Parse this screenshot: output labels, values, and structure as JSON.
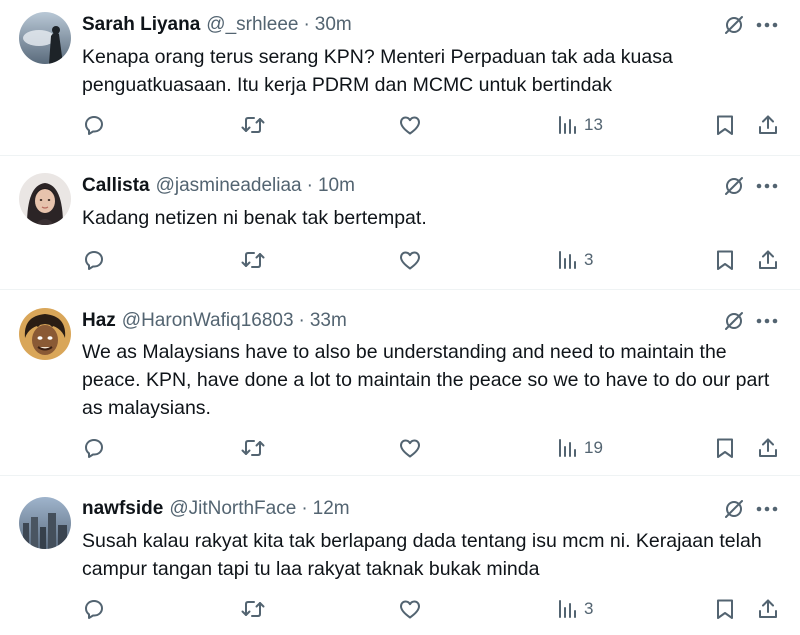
{
  "tweets": [
    {
      "name": "Sarah Liyana",
      "handle": "@_srhleee",
      "sep": "·",
      "time": "30m",
      "text": "Kenapa orang terus serang KPN? Menteri Perpaduan tak ada kuasa penguatkuasaan. Itu kerja PDRM dan MCMC untuk bertindak",
      "views": "13"
    },
    {
      "name": "Callista",
      "handle": "@jasmineadeliaa",
      "sep": "·",
      "time": "10m",
      "text": "Kadang netizen ni benak tak bertempat.",
      "views": "3"
    },
    {
      "name": "Haz",
      "handle": "@HaronWafiq16803",
      "sep": "·",
      "time": "33m",
      "text": "We as Malaysians have to also be understanding and need to maintain the peace. KPN, have done a lot to maintain the peace so we to have to do our part as malaysians.",
      "views": "19"
    },
    {
      "name": "nawfside",
      "handle": "@JitNorthFace",
      "sep": "·",
      "time": "12m",
      "text": "Susah kalau rakyat kita tak berlapang dada tentang isu mcm ni. Kerajaan telah campur tangan tapi tu laa rakyat taknak bukak minda",
      "views": "3"
    }
  ],
  "icons": {
    "reply": "reply-icon",
    "retweet": "retweet-icon",
    "like": "heart-icon",
    "views": "views-icon",
    "bookmark": "bookmark-icon",
    "share": "share-icon",
    "grok": "grok-icon",
    "more": "more-icon"
  },
  "colors": {
    "text": "#0f1419",
    "secondary": "#536471",
    "divider": "#eff3f4"
  }
}
